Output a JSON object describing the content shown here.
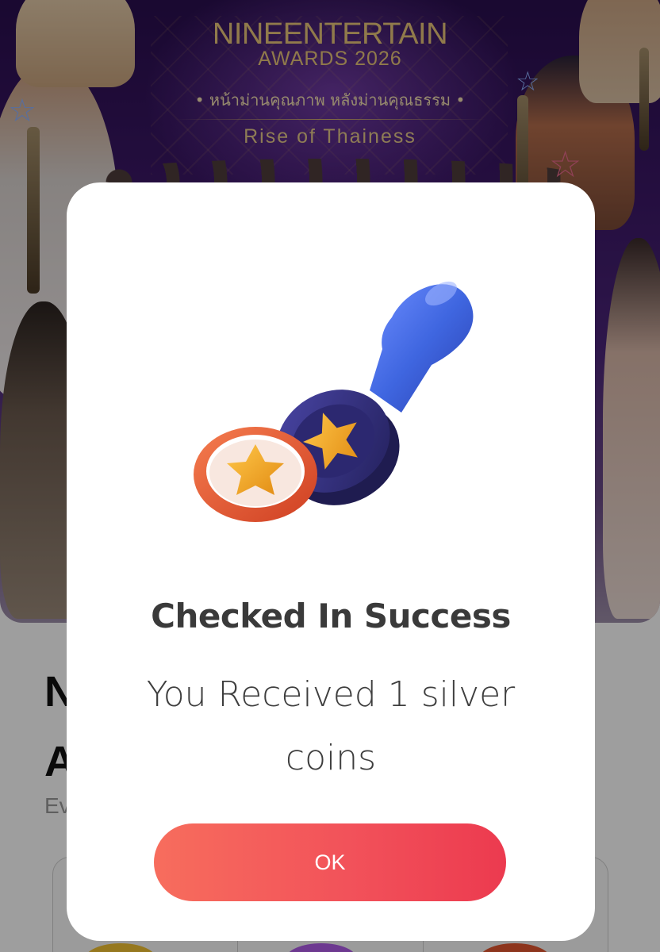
{
  "banner": {
    "title": "NINEENTERTAIN",
    "subtitle": "AWARDS 2026",
    "tagline": "• หน้าม่านคุณภาพ หลังม่านคุณธรรม •",
    "theme": "Rise of Thainess"
  },
  "page": {
    "heading_partial": "N\nA",
    "sub_partial": "Ev"
  },
  "dialog": {
    "title": "Checked In Success",
    "message": "You Received 1 silver coins",
    "ok_label": "OK"
  },
  "colors": {
    "ok_button_start": "#f76d5d",
    "ok_button_end": "#ec3a4f",
    "stamp_handle": "#3f66e0",
    "stamp_base": "#33307a",
    "star": "#f2a51f",
    "ring": "#e4562f"
  }
}
